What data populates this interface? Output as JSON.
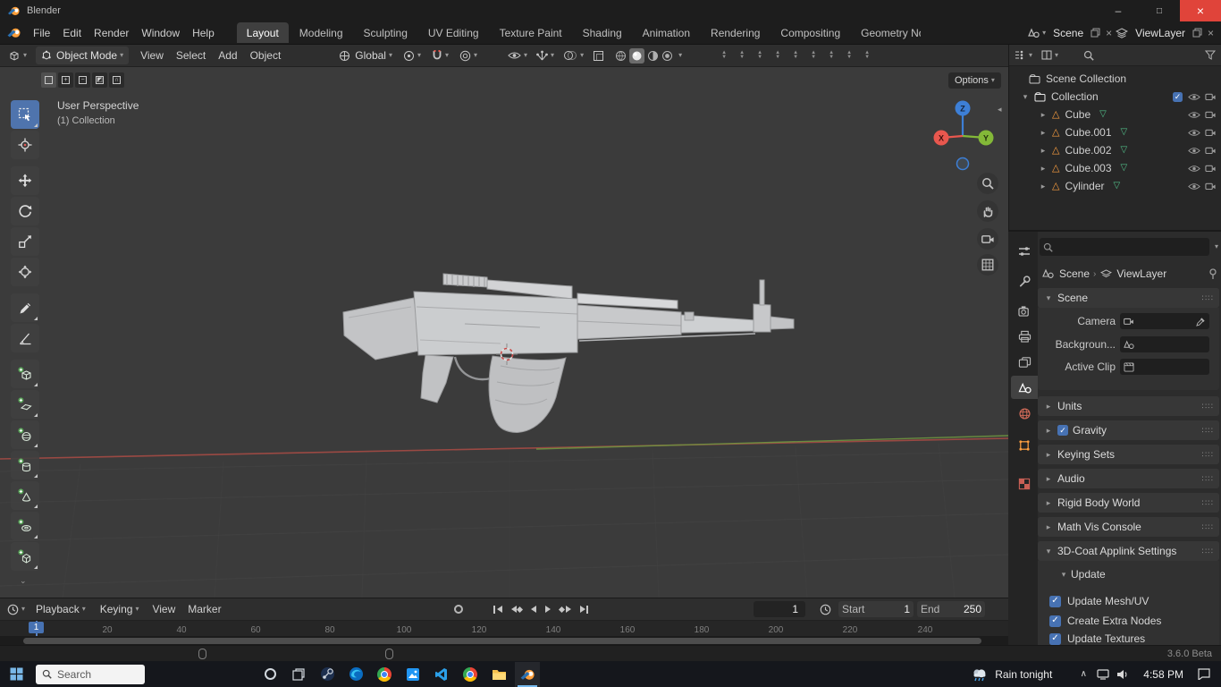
{
  "window": {
    "title": "Blender",
    "minimize": "–",
    "maximize": "□",
    "close": "×"
  },
  "menubar": {
    "items": [
      "File",
      "Edit",
      "Render",
      "Window",
      "Help"
    ]
  },
  "workspaces": {
    "tabs": [
      "Layout",
      "Modeling",
      "Sculpting",
      "UV Editing",
      "Texture Paint",
      "Shading",
      "Animation",
      "Rendering",
      "Compositing",
      "Geometry Noc"
    ],
    "active": "Layout"
  },
  "topbar_right": {
    "scene": "Scene",
    "view_layer": "ViewLayer"
  },
  "viewport_header": {
    "mode": "Object Mode",
    "view": "View",
    "select": "Select",
    "add": "Add",
    "object": "Object",
    "orientation": "Global"
  },
  "tool_settings": {
    "options": "Options"
  },
  "viewport": {
    "line1": "User Perspective",
    "line2": "(1) Collection",
    "x": "X",
    "y": "Y",
    "z": "Z"
  },
  "outliner": {
    "root": "Scene Collection",
    "collection": "Collection",
    "items": [
      "Cube",
      "Cube.001",
      "Cube.002",
      "Cube.003",
      "Cylinder"
    ]
  },
  "properties": {
    "crumb_scene": "Scene",
    "crumb_layer": "ViewLayer",
    "scene_title": "Scene",
    "camera": "Camera",
    "background": "Backgroun...",
    "active_clip": "Active Clip",
    "panels": [
      "Units",
      "Gravity",
      "Keying Sets",
      "Audio",
      "Rigid Body World",
      "Math Vis Console"
    ],
    "gravity_checked": true,
    "applink_title": "3D-Coat Applink Settings",
    "applink_update": "Update",
    "checks": [
      "Update Mesh/UV",
      "Create Extra Nodes",
      "Update Textures"
    ]
  },
  "timeline": {
    "playback": "Playback",
    "keying": "Keying",
    "view": "View",
    "marker": "Marker",
    "frame": "1",
    "start_label": "Start",
    "start": "1",
    "end_label": "End",
    "end": "250",
    "playhead": "1",
    "ruler": [
      "20",
      "40",
      "60",
      "80",
      "100",
      "120",
      "140",
      "160",
      "180",
      "200",
      "220",
      "240"
    ]
  },
  "statusbar": {
    "version": "3.6.0 Beta"
  },
  "taskbar": {
    "search": "Search",
    "weather": "Rain tonight",
    "time": "4:58 PM"
  },
  "colors": {
    "accent_blue": "#4772b3",
    "object_orange": "#ffa040",
    "data_green": "#52c08a",
    "axis_x_red": "#e8574e",
    "axis_y_green": "#83b838",
    "axis_z_blue": "#3d7fd6",
    "close_red": "#e0443a",
    "taskbar_highlight": "#76b9ed"
  }
}
